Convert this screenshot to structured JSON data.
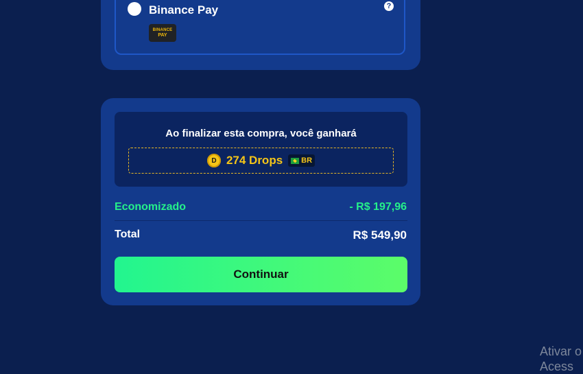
{
  "payment_option": {
    "label": "Binance Pay",
    "help": "?",
    "logo_line1": "BINANCE",
    "logo_line2": "PAY"
  },
  "reward": {
    "title": "Ao finalizar esta compra, você ganhará",
    "coin_symbol": "D",
    "amount": "274 Drops",
    "region": "BR"
  },
  "summary": {
    "saved_label": "Economizado",
    "saved_value": "- R$ 197,96",
    "total_label": "Total",
    "total_value": "R$ 549,90"
  },
  "actions": {
    "continue_label": "Continuar"
  },
  "watermark": {
    "line1": "Ativar o",
    "line2": "Acess"
  },
  "colors": {
    "background": "#0b1f4f",
    "card": "#133a8c",
    "accent_green": "#25f08a",
    "coin_gold": "#f5c518"
  }
}
